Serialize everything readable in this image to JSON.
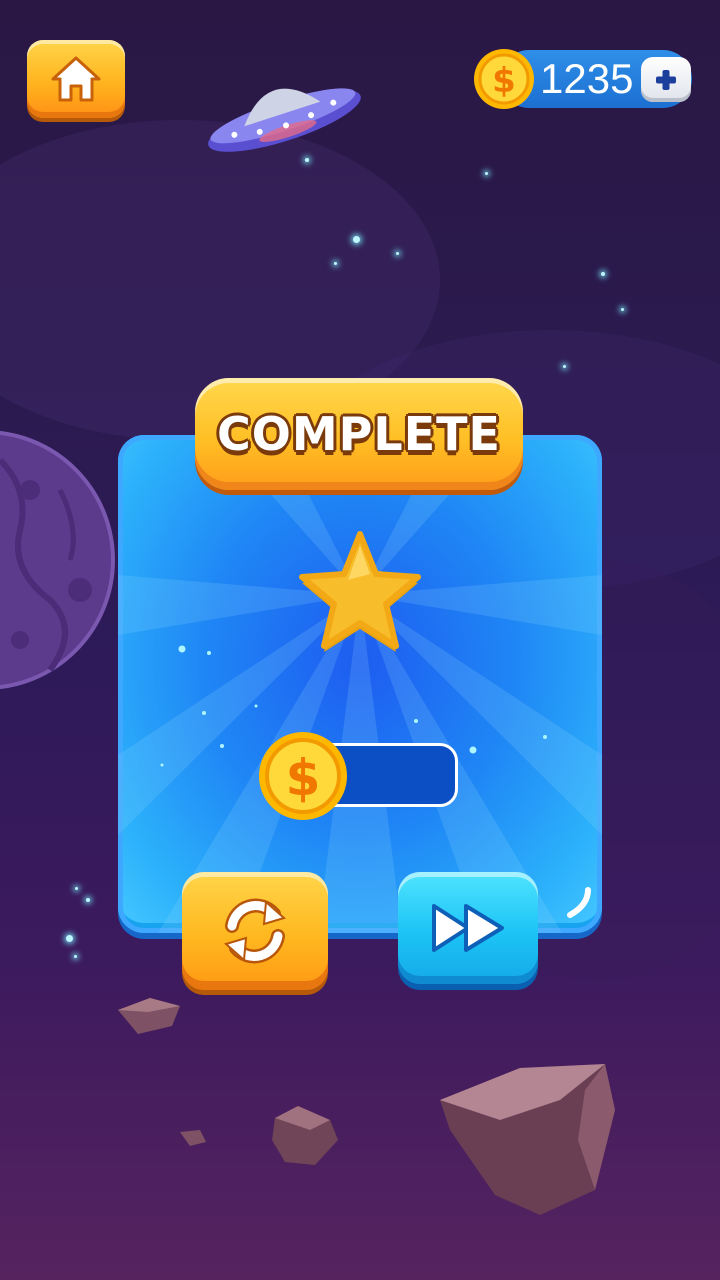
{
  "header": {
    "home_icon": "home-icon",
    "coins": "1235",
    "add_icon": "plus-icon"
  },
  "dialog": {
    "title": "COMPLETE",
    "stars_earned": 1,
    "reward_value": "",
    "replay_icon": "refresh-icon",
    "next_icon": "fast-forward-icon"
  },
  "colors": {
    "background_top": "#2a1744",
    "background_bottom": "#56235f",
    "panel_blue": "#1f86f5",
    "button_orange": "#ffb41f",
    "button_cyan": "#1cc3f5",
    "coin_gold": "#ffc21a"
  }
}
